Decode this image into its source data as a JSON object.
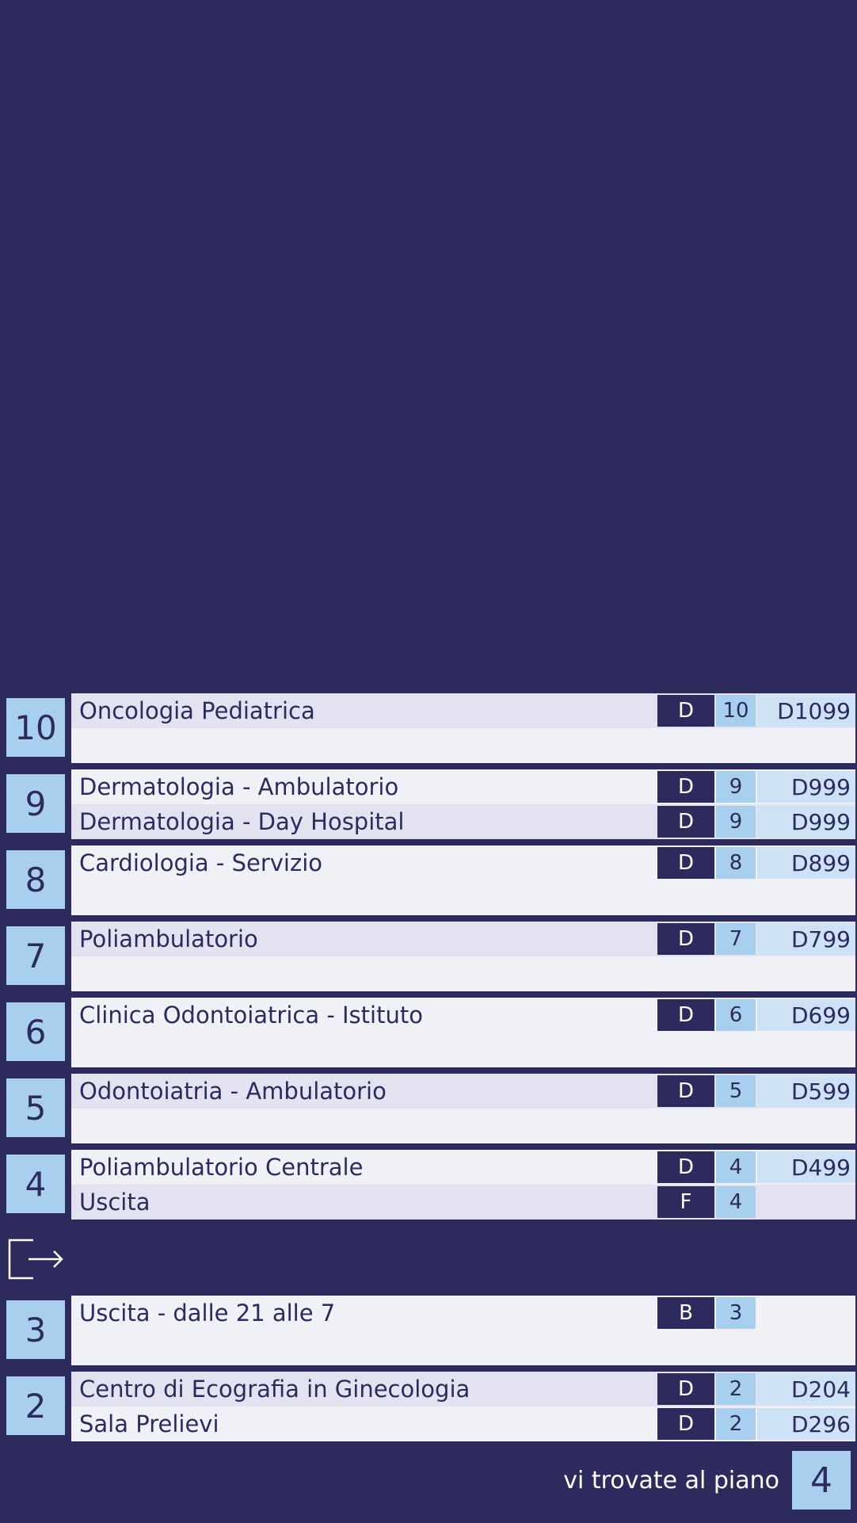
{
  "floors": [
    {
      "number": "10",
      "entries": [
        {
          "name": "Oncologia Pediatrica",
          "building": "D",
          "floor": "10",
          "room": "D1099"
        }
      ]
    },
    {
      "number": "9",
      "entries": [
        {
          "name": "Dermatologia - Ambulatorio",
          "building": "D",
          "floor": "9",
          "room": "D999"
        },
        {
          "name": "Dermatologia - Day Hospital",
          "building": "D",
          "floor": "9",
          "room": "D999"
        }
      ]
    },
    {
      "number": "8",
      "entries": [
        {
          "name": "Cardiologia - Servizio",
          "building": "D",
          "floor": "8",
          "room": "D899"
        }
      ]
    },
    {
      "number": "7",
      "entries": [
        {
          "name": "Poliambulatorio",
          "building": "D",
          "floor": "7",
          "room": "D799"
        }
      ]
    },
    {
      "number": "6",
      "entries": [
        {
          "name": "Clinica Odontoiatrica - Istituto",
          "building": "D",
          "floor": "6",
          "room": "D699"
        }
      ]
    },
    {
      "number": "5",
      "entries": [
        {
          "name": "Odontoiatria - Ambulatorio",
          "building": "D",
          "floor": "5",
          "room": "D599"
        }
      ]
    },
    {
      "number": "4",
      "entries": [
        {
          "name": "Poliambulatorio Centrale",
          "building": "D",
          "floor": "4",
          "room": "D499"
        },
        {
          "name": "Uscita",
          "building": "F",
          "floor": "4",
          "room": ""
        }
      ]
    },
    {
      "number": "3",
      "entries": [
        {
          "name": "Uscita - dalle 21 alle 7",
          "building": "B",
          "floor": "3",
          "room": ""
        }
      ]
    },
    {
      "number": "2",
      "entries": [
        {
          "name": "Centro di Ecografia in Ginecologia",
          "building": "D",
          "floor": "2",
          "room": "D204"
        },
        {
          "name": "Sala Prelievi",
          "building": "D",
          "floor": "2",
          "room": "D296"
        }
      ]
    }
  ],
  "exit_icon": "exit-icon",
  "footer": {
    "text": "vi trovate al piano",
    "current_floor": "4"
  },
  "colors": {
    "navy": "#2d2b5e",
    "light_blue": "#a8cfee",
    "pale_blue": "#cde3f5",
    "row_light": "#f0f0f7",
    "row_alt": "#e3e2f0"
  }
}
